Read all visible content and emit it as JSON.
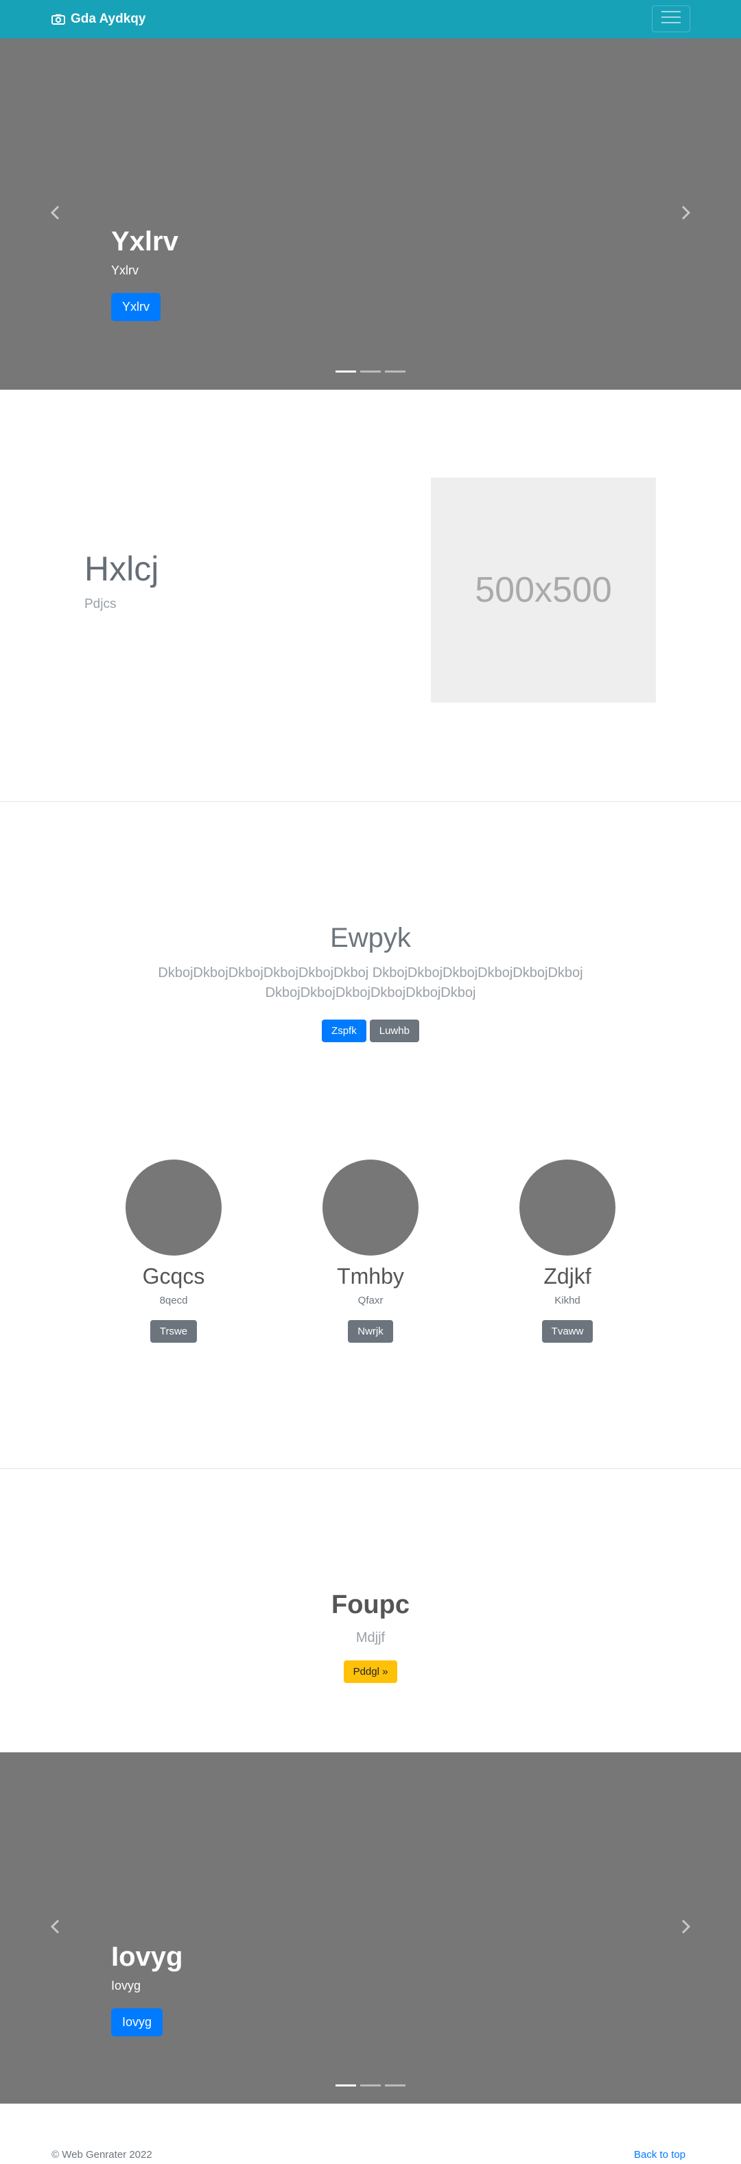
{
  "navbar": {
    "brand": "Gda Aydkqy",
    "brand_icon": "camera-icon",
    "toggler_icon": "hamburger-menu-icon"
  },
  "carousel_top": {
    "title": "Yxlrv",
    "subtitle": "Yxlrv",
    "button": "Yxlrv",
    "prev_icon": "chevron-left-icon",
    "next_icon": "chevron-right-icon",
    "indicators": 3
  },
  "featurette": {
    "title": "Hxlcj",
    "subtitle": "Pdjcs",
    "placeholder": "500x500"
  },
  "jumbotron": {
    "title": "Ewpyk",
    "text": "DkbojDkbojDkbojDkbojDkbojDkboj DkbojDkbojDkbojDkbojDkbojDkboj DkbojDkbojDkbojDkbojDkbojDkboj",
    "primary_button": "Zspfk",
    "secondary_button": "Luwhb"
  },
  "people": [
    {
      "name": "Gcqcs",
      "subtitle": "8qecd",
      "button": "Trswe"
    },
    {
      "name": "Tmhby",
      "subtitle": "Qfaxr",
      "button": "Nwrjk"
    },
    {
      "name": "Zdjkf",
      "subtitle": "Kikhd",
      "button": "Tvaww"
    }
  ],
  "cta": {
    "title": "Foupc",
    "subtitle": "Mdjjf",
    "button": "Pddgl »"
  },
  "carousel_bottom": {
    "title": "Iovyg",
    "subtitle": "Iovyg",
    "button": "Iovyg",
    "prev_icon": "chevron-left-icon",
    "next_icon": "chevron-right-icon",
    "indicators": 3
  },
  "footer": {
    "copyright": "© Web Genrater 2022",
    "back_to_top": "Back to top"
  },
  "colors": {
    "navbar": "#17a2b8",
    "carousel_bg": "#777777",
    "primary": "#007bff",
    "secondary": "#6c757d",
    "warning": "#ffc107"
  }
}
